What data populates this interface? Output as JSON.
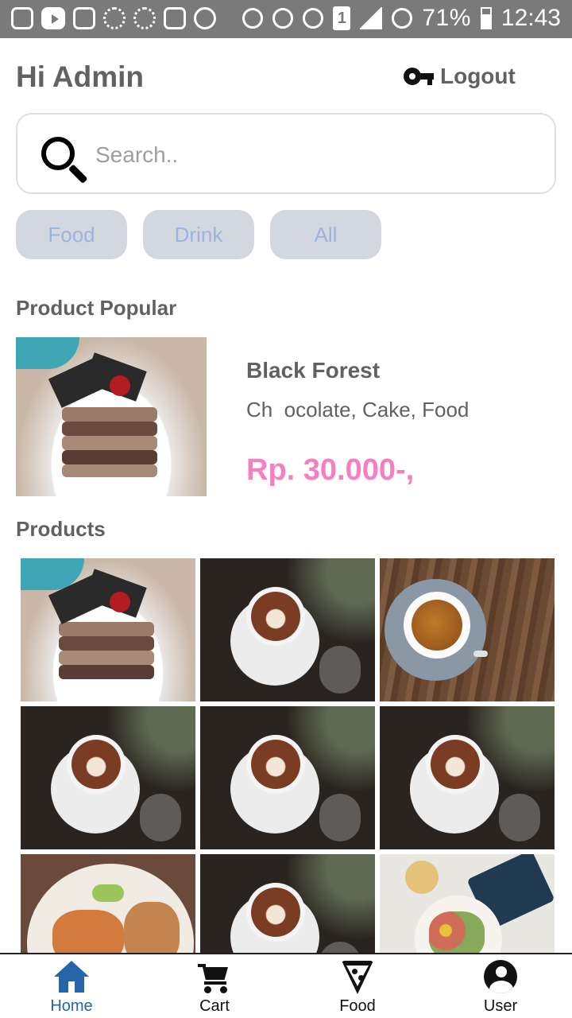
{
  "status_bar": {
    "battery": "71%",
    "time": "12:43",
    "sim": "1"
  },
  "header": {
    "greeting": "Hi Admin",
    "logout_label": "Logout"
  },
  "search": {
    "placeholder": "Search..",
    "value": ""
  },
  "categories": [
    "Food",
    "Drink",
    "All"
  ],
  "popular": {
    "section_title": "Product Popular",
    "name": "Black Forest",
    "categories": "Ch  ocolate, Cake, Food",
    "price": "Rp. 30.000-,"
  },
  "products": {
    "section_title": "Products",
    "items": [
      "cake",
      "latte",
      "espresso",
      "latte",
      "latte",
      "latte",
      "salmon-bowl",
      "latte",
      "plate"
    ]
  },
  "bottom_nav": {
    "items": [
      {
        "label": "Home",
        "icon": "home-icon",
        "active": true
      },
      {
        "label": "Cart",
        "icon": "cart-icon",
        "active": false
      },
      {
        "label": "Food",
        "icon": "pizza-icon",
        "active": false
      },
      {
        "label": "User",
        "icon": "user-icon",
        "active": false
      }
    ]
  },
  "colors": {
    "accent_price": "#f77fbf",
    "active_nav": "#2565a8",
    "chip_bg": "#d3d7df",
    "chip_text": "#9bb4de"
  }
}
